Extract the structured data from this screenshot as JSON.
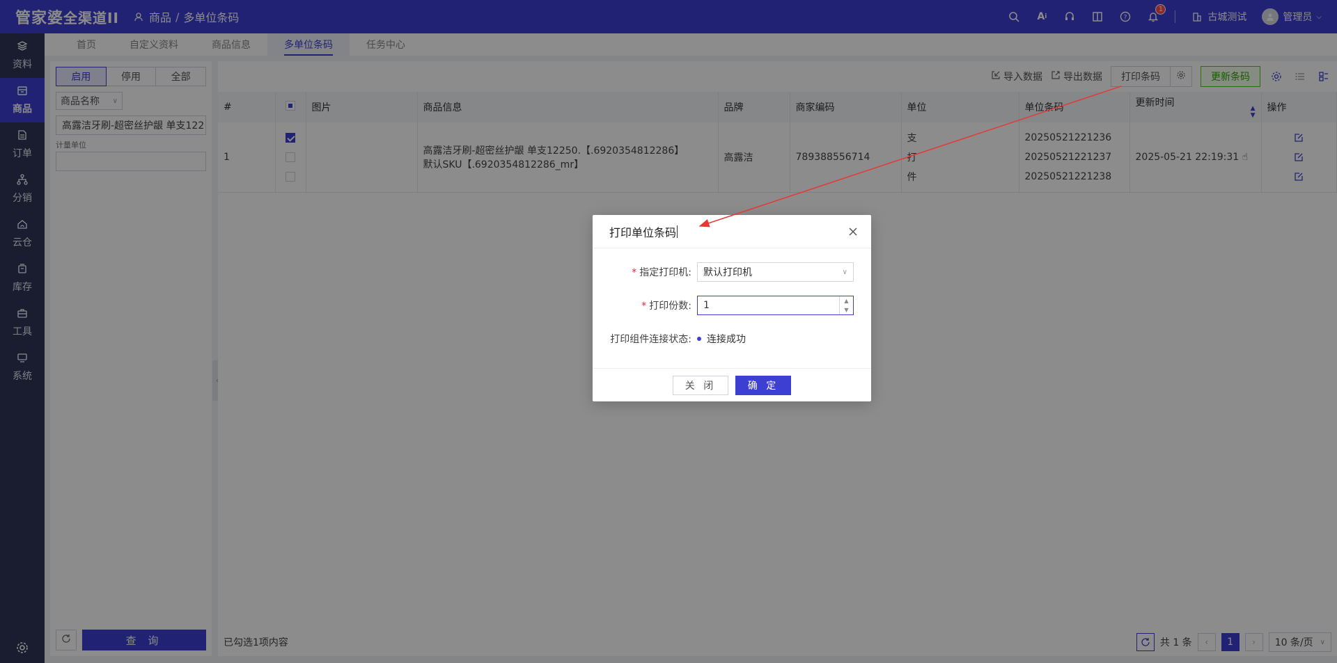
{
  "topbar": {
    "logo_main": "管家婆",
    "logo_sub": "全渠道II",
    "breadcrumb_parent": "商品",
    "breadcrumb_sep": "/",
    "breadcrumb_current": "多单位条码",
    "notification_count": "1",
    "company": "古城测试",
    "user": "管理员",
    "bar_color": "#3c3fd1"
  },
  "sidebar": {
    "items": [
      {
        "label": "资料",
        "icon": "layers-icon"
      },
      {
        "label": "商品",
        "icon": "box-icon",
        "active": true
      },
      {
        "label": "订单",
        "icon": "document-icon"
      },
      {
        "label": "分销",
        "icon": "network-icon"
      },
      {
        "label": "云仓",
        "icon": "cloud-house-icon"
      },
      {
        "label": "库存",
        "icon": "stack-icon"
      },
      {
        "label": "工具",
        "icon": "toolbox-icon"
      },
      {
        "label": "系统",
        "icon": "monitor-icon"
      }
    ]
  },
  "tabs": [
    "首页",
    "自定义资料",
    "商品信息",
    "多单位条码",
    "任务中心"
  ],
  "filter": {
    "status_buttons": [
      "启用",
      "停用",
      "全部"
    ],
    "field_select": "商品名称",
    "search_value": "高露洁牙刷-超密丝护龈 单支122",
    "unit_label": "计量单位",
    "query_label": "查 询"
  },
  "toolbar": {
    "import": "导入数据",
    "export": "导出数据",
    "print": "打印条码",
    "update": "更新条码"
  },
  "table": {
    "headers": [
      "#",
      "",
      "图片",
      "商品信息",
      "品牌",
      "商家编码",
      "单位",
      "单位条码",
      "更新时间",
      "操作"
    ],
    "row": {
      "index": "1",
      "product_line1": "高露洁牙刷-超密丝护龈 单支12250.【.6920354812286】",
      "product_line2": "默认SKU【.6920354812286_mr】",
      "brand": "高露洁",
      "merchant_code": "789388556714",
      "units": [
        "支",
        "打",
        "件"
      ],
      "barcodes": [
        "20250521221236",
        "20250521221237",
        "20250521221238"
      ],
      "updated": "2025-05-21 22:19:31"
    }
  },
  "footer": {
    "selected_text": "已勾选1项内容",
    "total_text": "共 1 条",
    "current_page": "1",
    "page_size": "10 条/页"
  },
  "modal": {
    "title": "打印单位条码",
    "printer_label": "指定打印机:",
    "printer_value": "默认打印机",
    "copies_label": "打印份数:",
    "copies_value": "1",
    "status_label": "打印组件连接状态:",
    "status_value": "连接成功",
    "close_button": "关 闭",
    "confirm_button": "确 定"
  }
}
